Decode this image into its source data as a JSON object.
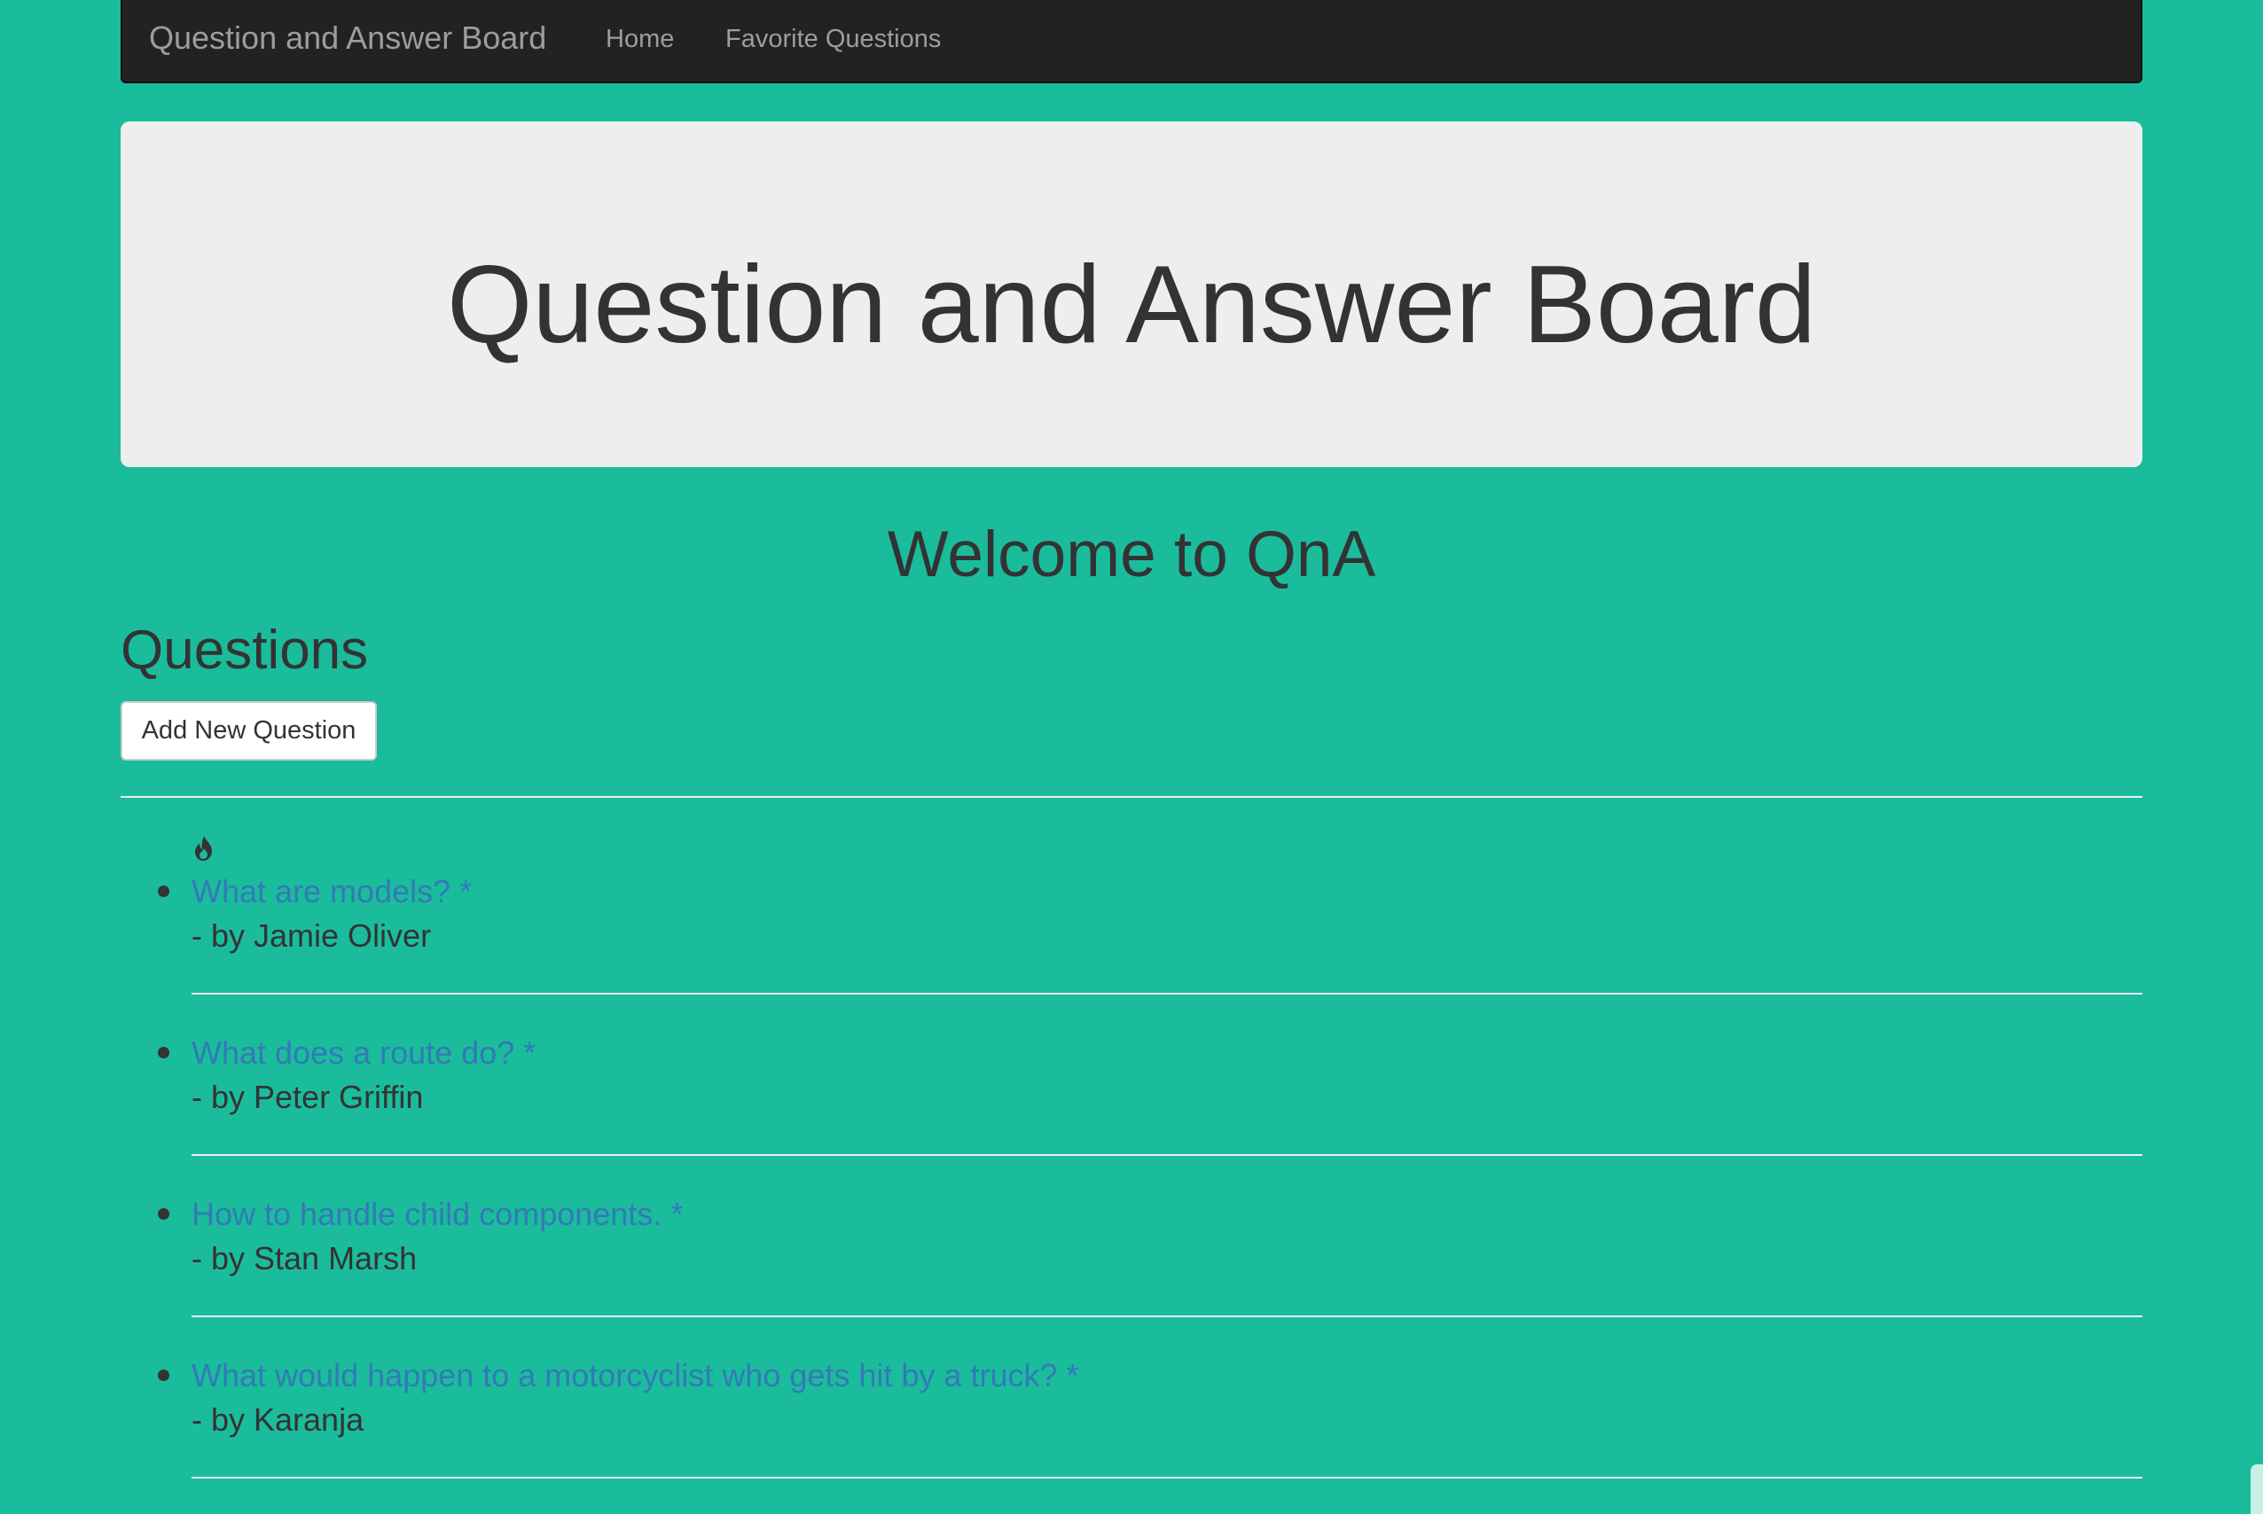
{
  "navbar": {
    "brand": "Question and Answer Board",
    "links": [
      {
        "label": "Home"
      },
      {
        "label": "Favorite Questions"
      }
    ]
  },
  "jumbotron": {
    "title": "Question and Answer Board"
  },
  "welcome": "Welcome to QnA",
  "questions_section": {
    "heading": "Questions",
    "add_button_label": "Add New Question",
    "items": [
      {
        "title": "What are models? *",
        "author": "- by Jamie Oliver"
      },
      {
        "title": "What does a route do? *",
        "author": "- by Peter Griffin"
      },
      {
        "title": "How to handle child components. *",
        "author": "- by Stan Marsh"
      },
      {
        "title": "What would happen to a motorcyclist who gets hit by a truck? *",
        "author": "- by Karanja"
      }
    ]
  },
  "colors": {
    "background": "#1abc9c",
    "navbar": "#222222",
    "link": "#337ab7",
    "jumbotron": "#eeeeee"
  },
  "icons": {
    "first_item_icon": "flame-icon"
  }
}
